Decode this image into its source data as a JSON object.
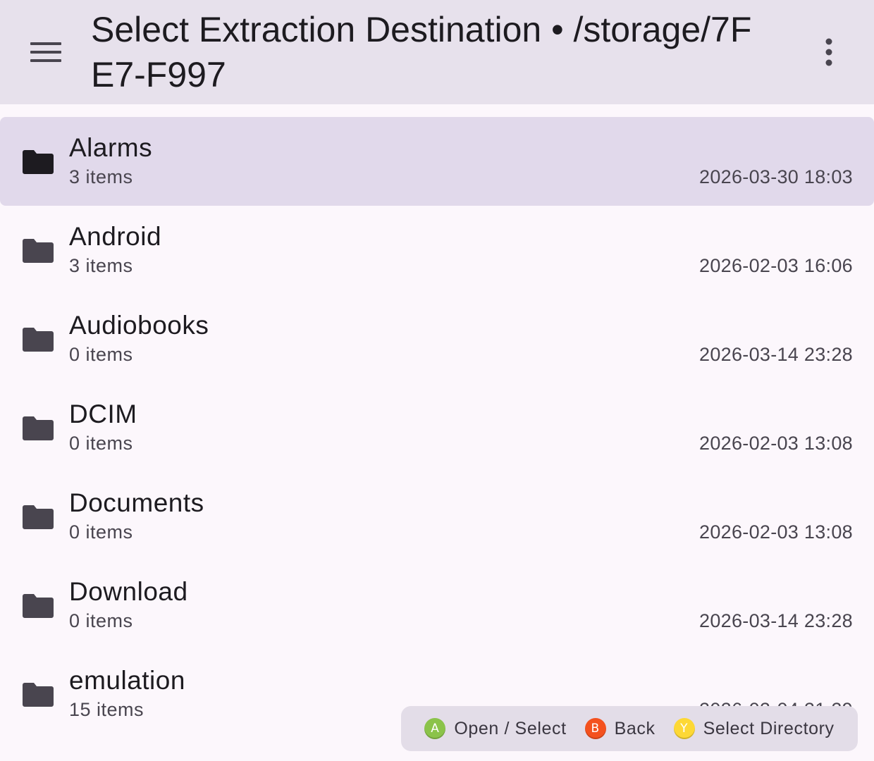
{
  "appbar": {
    "title": "Select Extraction Destination • /storage/7FE7-F997",
    "menu_icon": "hamburger-menu-icon",
    "more_icon": "more-vert-icon"
  },
  "folders": [
    {
      "name": "Alarms",
      "count": "3 items",
      "date": "2026-03-30 18:03",
      "selected": true
    },
    {
      "name": "Android",
      "count": "3 items",
      "date": "2026-02-03 16:06"
    },
    {
      "name": "Audiobooks",
      "count": "0 items",
      "date": "2026-03-14 23:28"
    },
    {
      "name": "DCIM",
      "count": "0 items",
      "date": "2026-02-03 13:08"
    },
    {
      "name": "Documents",
      "count": "0 items",
      "date": "2026-02-03 13:08"
    },
    {
      "name": "Download",
      "count": "0 items",
      "date": "2026-03-14 23:28"
    },
    {
      "name": "emulation",
      "count": "15 items",
      "date": "2026-02-04 21:29"
    }
  ],
  "hints": [
    {
      "key": "A",
      "label": "Open / Select",
      "color": "#8bc34a"
    },
    {
      "key": "B",
      "label": "Back",
      "color": "#f4511e"
    },
    {
      "key": "Y",
      "label": "Select Directory",
      "color": "#fdd835"
    }
  ],
  "colors": {
    "appbar_bg": "#e7e1ec",
    "selected_row": "#e1d9eb",
    "folder_icon": "#49454f",
    "folder_icon_selected": "#1d1b20"
  }
}
